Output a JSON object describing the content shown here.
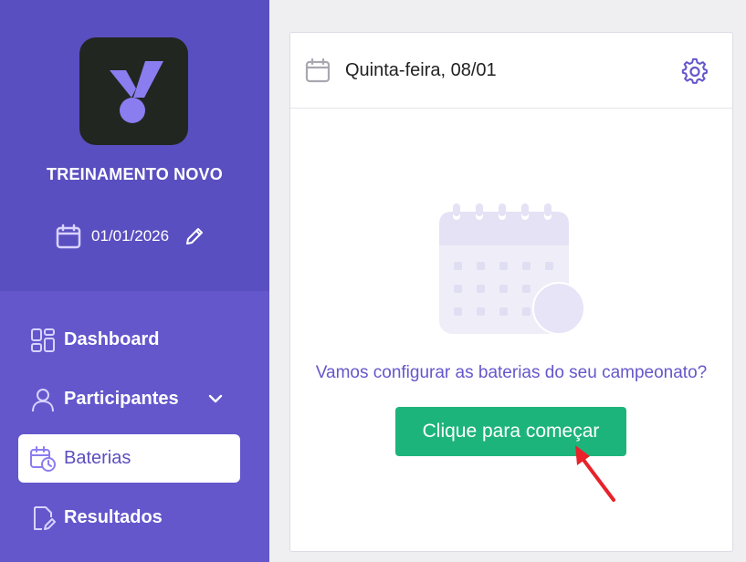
{
  "sidebar": {
    "event_name": "TREINAMENTO NOVO",
    "event_date": "01/01/2026",
    "nav": [
      {
        "label": "Dashboard",
        "icon": "grid-icon"
      },
      {
        "label": "Participantes",
        "icon": "user-icon"
      },
      {
        "label": "Baterias",
        "icon": "calendar-clock-icon"
      },
      {
        "label": "Resultados",
        "icon": "document-edit-icon"
      }
    ],
    "active_item": "Baterias"
  },
  "main": {
    "header_date": "Quinta-feira, 08/01",
    "empty_prompt": "Vamos configurar as baterias do seu campeonato?",
    "start_button": "Clique para começar"
  },
  "colors": {
    "sidebar": "#6457cc",
    "sidebar_top": "#5a4fc0",
    "accent": "#6457cc",
    "button": "#1db47c",
    "arrow": "#e8212b"
  }
}
